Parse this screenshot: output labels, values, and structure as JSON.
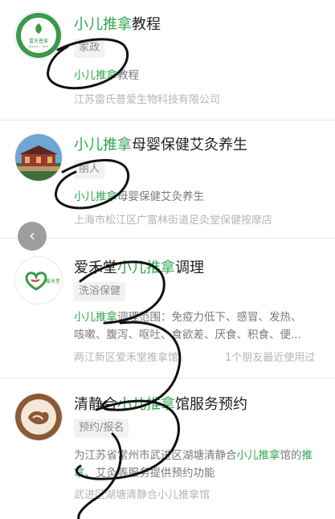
{
  "results": [
    {
      "title_hl": "小儿推拿",
      "title_rest": "教程",
      "tag": "家政",
      "desc_hl": "小儿推拿",
      "desc_rest": "教程",
      "meta": "江苏雷氏普爱生物科技有限公司",
      "logo_text": "雷氏普爱",
      "logo_sub": "BIOLOGY · TECH"
    },
    {
      "title_hl": "小儿推拿",
      "title_rest": "母婴保健艾灸养生",
      "tag": "丽人",
      "desc_hl": "小儿推拿",
      "desc_rest": "母婴保健艾灸养生",
      "meta": "上海市松江区广富林街道足灸堂保健按摩店"
    },
    {
      "title_pre": "爱禾堂",
      "title_hl": "小儿推拿",
      "title_rest": "调理",
      "tag": "洗浴保健",
      "desc_hl": "小儿推拿",
      "desc_rest": "调理范围：免疫力低下、感冒、发热、",
      "desc_line2": "咳嗽、腹泻、呕吐、食欲差、厌食、积食、便...",
      "meta": "两江新区爱禾堂推拿馆",
      "meta_right": "1个朋友最近使用过",
      "logo_text": "爱禾堂"
    },
    {
      "title_pre": "清静合",
      "title_hl": "小儿推拿",
      "title_rest": "馆服务预约",
      "tag": "预约/报名",
      "desc_pre": "为江苏省常州市武进区湖塘清静合",
      "desc_hl": "小儿推拿",
      "desc_mid": "馆的",
      "desc_hl2": "推拿",
      "desc_rest": "、艾灸等服务提供预约功能",
      "meta": "武进区湖塘清静合小儿推拿馆"
    }
  ],
  "back_button": {
    "label": "‹"
  },
  "colors": {
    "highlight": "#2fa84f",
    "text": "#222222",
    "muted": "#b5b5b5"
  }
}
